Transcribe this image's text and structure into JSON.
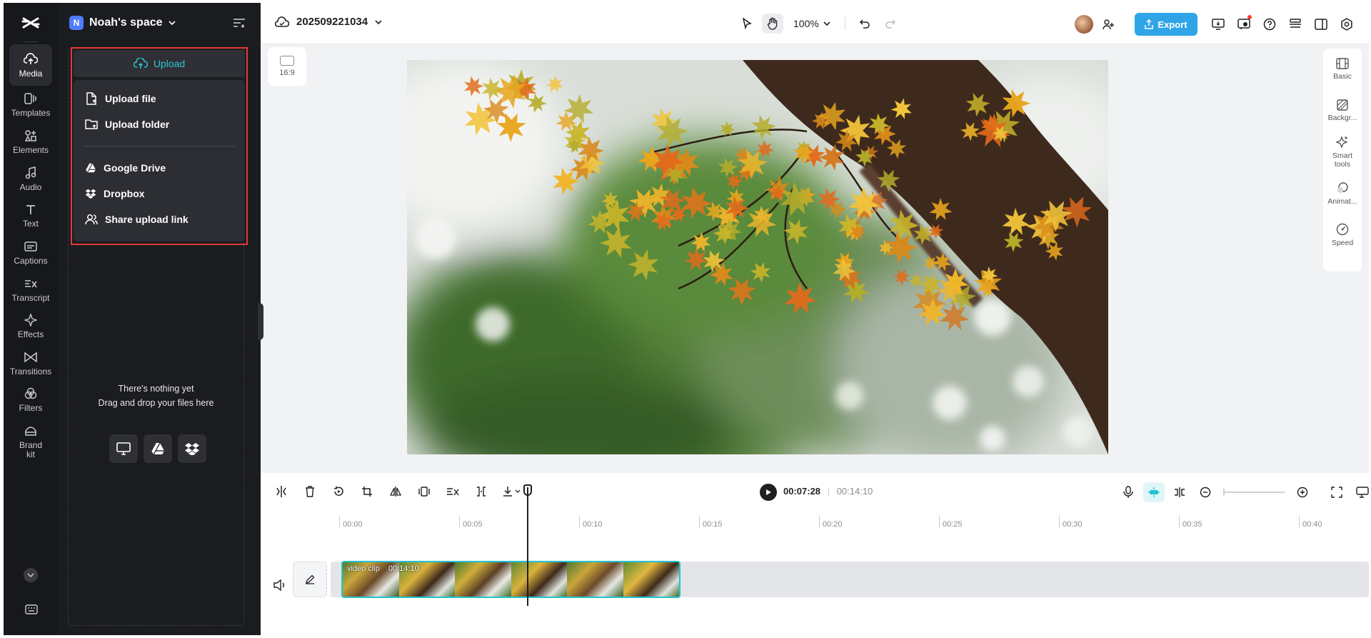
{
  "rail": {
    "items": [
      {
        "label": "Media"
      },
      {
        "label": "Templates"
      },
      {
        "label": "Elements"
      },
      {
        "label": "Audio"
      },
      {
        "label": "Text"
      },
      {
        "label": "Captions"
      },
      {
        "label": "Transcript"
      },
      {
        "label": "Effects"
      },
      {
        "label": "Transitions"
      },
      {
        "label": "Filters"
      },
      {
        "label": "Brand kit"
      }
    ]
  },
  "panel": {
    "space_badge": "N",
    "space_name": "Noah's space",
    "upload_label": "Upload",
    "menu": [
      {
        "label": "Upload file",
        "icon": "file-upload-icon"
      },
      {
        "label": "Upload folder",
        "icon": "folder-upload-icon"
      },
      {
        "label": "Google Drive",
        "icon": "google-drive-icon"
      },
      {
        "label": "Dropbox",
        "icon": "dropbox-icon"
      },
      {
        "label": "Share upload link",
        "icon": "share-users-icon"
      }
    ],
    "empty_line1": "There's nothing yet",
    "empty_line2": "Drag and drop your files here"
  },
  "topbar": {
    "project_name": "202509221034",
    "zoom": "100%",
    "export_label": "Export"
  },
  "canvas": {
    "ratio_label": "16:9"
  },
  "right_panel": {
    "items": [
      {
        "label": "Basic",
        "icon": "basic-icon"
      },
      {
        "label": "Backgr...",
        "icon": "background-icon"
      },
      {
        "label": "Smart tools",
        "icon": "sparkle-icon"
      },
      {
        "label": "Animat...",
        "icon": "animation-icon"
      },
      {
        "label": "Speed",
        "icon": "speed-icon"
      }
    ]
  },
  "timeline": {
    "current_time": "00:07:28",
    "total_time": "00:14:10",
    "ruler": [
      "00:00",
      "00:05",
      "00:10",
      "00:15",
      "00:20",
      "00:25",
      "00:30",
      "00:35",
      "00:40"
    ],
    "clip_name": "video clip",
    "clip_duration": "00:14:10",
    "playhead_fraction": 0.527
  },
  "colors": {
    "accent": "#2fa5e8",
    "upload_text": "#2ec5d6",
    "highlight_border": "#e53935",
    "clip_border": "#22c3d2"
  }
}
